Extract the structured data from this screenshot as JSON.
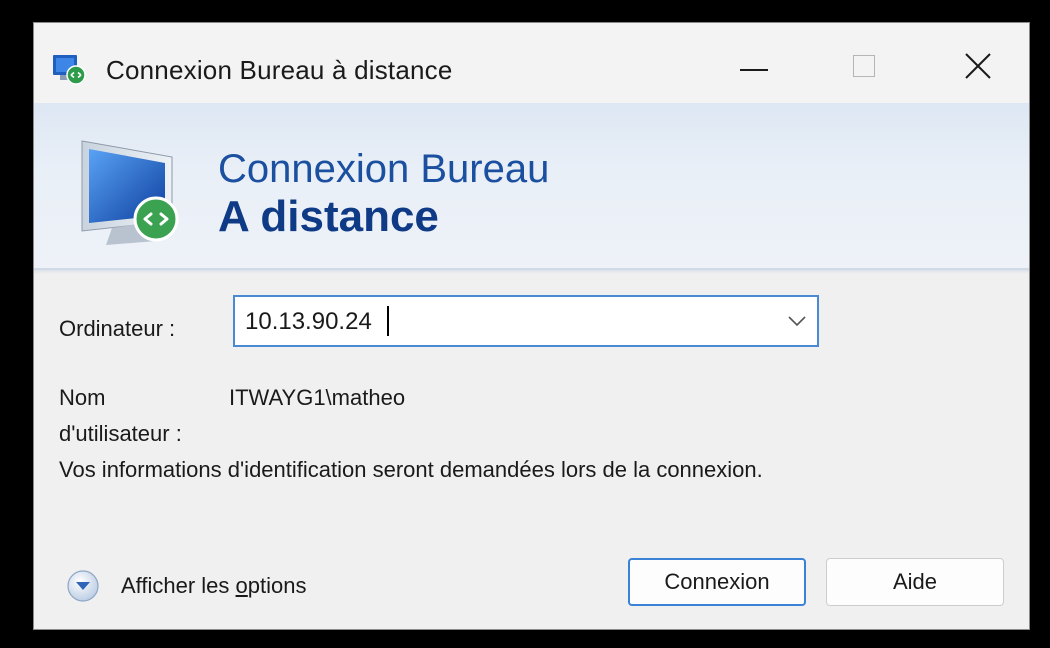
{
  "window": {
    "title": "Connexion Bureau à distance",
    "controls": {
      "minimize": "minimize-icon",
      "maximize": "maximize-icon",
      "close": "close-icon"
    }
  },
  "banner": {
    "line1": "Connexion Bureau",
    "line2": "A distance",
    "icon": "remote-desktop-monitor-icon",
    "colors": {
      "line1": "#1b4fa0",
      "line2": "#0e3a86"
    }
  },
  "form": {
    "computer_label": "Ordinateur :",
    "computer_value": "10.13.90.24",
    "username_label_line1": "Nom",
    "username_label_line2": "d'utilisateur :",
    "username_value": "ITWAYG1\\matheo",
    "info_text": "Vos informations d'identification seront demandées lors de la connexion."
  },
  "options": {
    "label_prefix": "Afficher les ",
    "label_access_key": "o",
    "label_suffix": "ptions",
    "icon": "expand-down-icon"
  },
  "buttons": {
    "connect": "Connexion",
    "help": "Aide"
  },
  "accent_color": "#3a82d6"
}
